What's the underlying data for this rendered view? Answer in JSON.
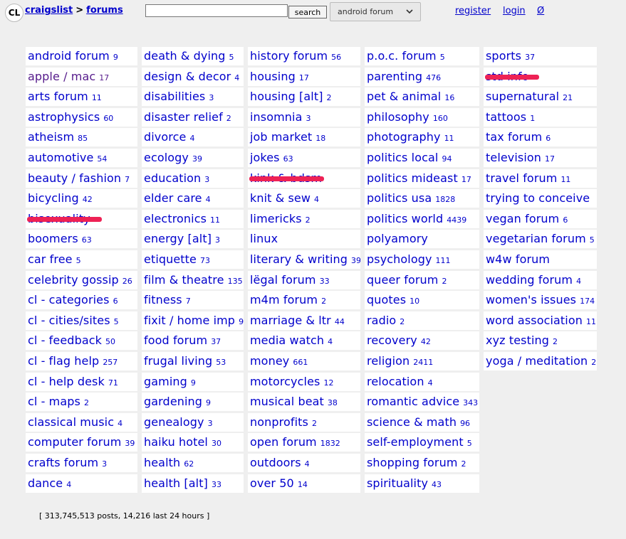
{
  "header": {
    "logo": "CL",
    "crumb_home": "craigslist",
    "crumb_sep": ">",
    "crumb_page": "forums",
    "search_value": "",
    "search_button": "search",
    "forum_select": "android forum",
    "register": "register",
    "login": "login",
    "extra": "Ø"
  },
  "columns": [
    [
      {
        "name": "android forum",
        "count": "9"
      },
      {
        "name": "apple / mac",
        "count": "17",
        "visited": true
      },
      {
        "name": "arts forum",
        "count": "11"
      },
      {
        "name": "astrophysics",
        "count": "60"
      },
      {
        "name": "atheism",
        "count": "85"
      },
      {
        "name": "automotive",
        "count": "54"
      },
      {
        "name": "beauty / fashion",
        "count": "7"
      },
      {
        "name": "bicycling",
        "count": "42"
      },
      {
        "name": "bisexuality",
        "count": "",
        "redacted": true
      },
      {
        "name": "boomers",
        "count": "63"
      },
      {
        "name": "car free",
        "count": "5"
      },
      {
        "name": "celebrity gossip",
        "count": "26"
      },
      {
        "name": "cl - categories",
        "count": "6"
      },
      {
        "name": "cl - cities/sites",
        "count": "5"
      },
      {
        "name": "cl - feedback",
        "count": "50"
      },
      {
        "name": "cl - flag help",
        "count": "257"
      },
      {
        "name": "cl - help desk",
        "count": "71"
      },
      {
        "name": "cl - maps",
        "count": "2"
      },
      {
        "name": "classical music",
        "count": "4"
      },
      {
        "name": "computer forum",
        "count": "39"
      },
      {
        "name": "crafts forum",
        "count": "3"
      },
      {
        "name": "dance",
        "count": "4"
      }
    ],
    [
      {
        "name": "death & dying",
        "count": "5"
      },
      {
        "name": "design & decor",
        "count": "4"
      },
      {
        "name": "disabilities",
        "count": "3"
      },
      {
        "name": "disaster relief",
        "count": "2"
      },
      {
        "name": "divorce",
        "count": "4"
      },
      {
        "name": "ecology",
        "count": "39"
      },
      {
        "name": "education",
        "count": "3"
      },
      {
        "name": "elder care",
        "count": "4"
      },
      {
        "name": "electronics",
        "count": "11"
      },
      {
        "name": "energy [alt]",
        "count": "3"
      },
      {
        "name": "etiquette",
        "count": "73"
      },
      {
        "name": "film & theatre",
        "count": "135"
      },
      {
        "name": "fitness",
        "count": "7"
      },
      {
        "name": "fixit / home imp",
        "count": "9"
      },
      {
        "name": "food forum",
        "count": "37"
      },
      {
        "name": "frugal living",
        "count": "53"
      },
      {
        "name": "gaming",
        "count": "9"
      },
      {
        "name": "gardening",
        "count": "9"
      },
      {
        "name": "genealogy",
        "count": "3"
      },
      {
        "name": "haiku hotel",
        "count": "30"
      },
      {
        "name": "health",
        "count": "62"
      },
      {
        "name": "health [alt]",
        "count": "33"
      }
    ],
    [
      {
        "name": "history forum",
        "count": "56"
      },
      {
        "name": "housing",
        "count": "17"
      },
      {
        "name": "housing [alt]",
        "count": "2"
      },
      {
        "name": "insomnia",
        "count": "3"
      },
      {
        "name": "job market",
        "count": "18"
      },
      {
        "name": "jokes",
        "count": "63"
      },
      {
        "name": "kink & bdsm",
        "count": "",
        "redacted": true
      },
      {
        "name": "knit & sew",
        "count": "4"
      },
      {
        "name": "limericks",
        "count": "2"
      },
      {
        "name": "linux",
        "count": ""
      },
      {
        "name": "literary & writing",
        "count": "39"
      },
      {
        "name": "lëgal forum",
        "count": "33"
      },
      {
        "name": "m4m forum",
        "count": "2"
      },
      {
        "name": "marriage & ltr",
        "count": "44"
      },
      {
        "name": "media watch",
        "count": "4"
      },
      {
        "name": "money",
        "count": "661"
      },
      {
        "name": "motorcycles",
        "count": "12"
      },
      {
        "name": "musical beat",
        "count": "38"
      },
      {
        "name": "nonprofits",
        "count": "2"
      },
      {
        "name": "open forum",
        "count": "1832"
      },
      {
        "name": "outdoors",
        "count": "4"
      },
      {
        "name": "over 50",
        "count": "14"
      }
    ],
    [
      {
        "name": "p.o.c. forum",
        "count": "5"
      },
      {
        "name": "parenting",
        "count": "476"
      },
      {
        "name": "pet & animal",
        "count": "16"
      },
      {
        "name": "philosophy",
        "count": "160"
      },
      {
        "name": "photography",
        "count": "11"
      },
      {
        "name": "politics local",
        "count": "94"
      },
      {
        "name": "politics mideast",
        "count": "17"
      },
      {
        "name": "politics usa",
        "count": "1828"
      },
      {
        "name": "politics world",
        "count": "4439"
      },
      {
        "name": "polyamory",
        "count": ""
      },
      {
        "name": "psychology",
        "count": "111"
      },
      {
        "name": "queer forum",
        "count": "2"
      },
      {
        "name": "quotes",
        "count": "10"
      },
      {
        "name": "radio",
        "count": "2"
      },
      {
        "name": "recovery",
        "count": "42"
      },
      {
        "name": "religion",
        "count": "2411"
      },
      {
        "name": "relocation",
        "count": "4"
      },
      {
        "name": "romantic advice",
        "count": "343"
      },
      {
        "name": "science & math",
        "count": "96"
      },
      {
        "name": "self-employment",
        "count": "5"
      },
      {
        "name": "shopping forum",
        "count": "2"
      },
      {
        "name": "spirituality",
        "count": "43"
      }
    ],
    [
      {
        "name": "sports",
        "count": "37"
      },
      {
        "name": "std info",
        "count": "",
        "redacted": true
      },
      {
        "name": "supernatural",
        "count": "21"
      },
      {
        "name": "tattoos",
        "count": "1"
      },
      {
        "name": "tax forum",
        "count": "6"
      },
      {
        "name": "television",
        "count": "17"
      },
      {
        "name": "travel forum",
        "count": "11"
      },
      {
        "name": "trying to conceive",
        "count": ""
      },
      {
        "name": "vegan forum",
        "count": "6"
      },
      {
        "name": "vegetarian forum",
        "count": "5"
      },
      {
        "name": "w4w forum",
        "count": ""
      },
      {
        "name": "wedding forum",
        "count": "4"
      },
      {
        "name": "women's issues",
        "count": "174"
      },
      {
        "name": "word association",
        "count": "11"
      },
      {
        "name": "xyz testing",
        "count": "2"
      },
      {
        "name": "yoga / meditation",
        "count": "2"
      }
    ]
  ],
  "footer": {
    "text": "[ 313,745,513 posts, 14,216 last 24 hours ]"
  }
}
